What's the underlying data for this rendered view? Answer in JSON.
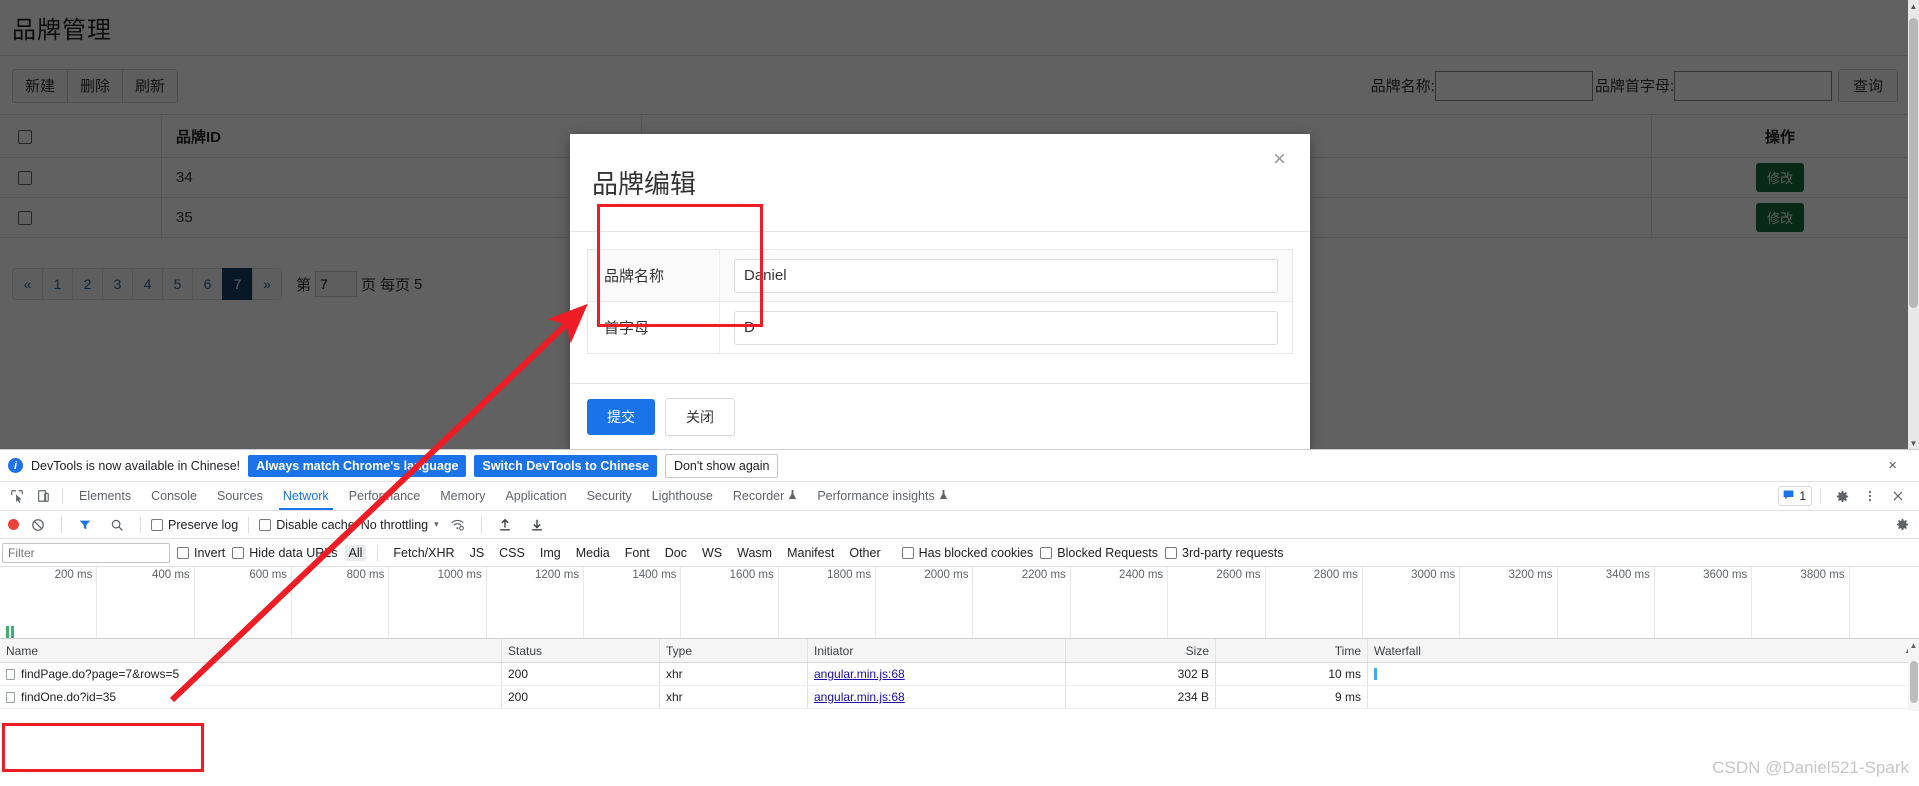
{
  "page": {
    "title": "品牌管理",
    "toolbar_buttons": [
      {
        "label": "新建"
      },
      {
        "label": "删除"
      },
      {
        "label": "刷新"
      }
    ],
    "search": {
      "name_label": "品牌名称:",
      "name_value": "",
      "initial_label": "品牌首字母:",
      "initial_value": "",
      "query_label": "查询"
    },
    "table": {
      "headers": {
        "id": "品牌ID",
        "operation": "操作"
      },
      "rows": [
        {
          "id": "34",
          "action_label": "修改"
        },
        {
          "id": "35",
          "action_label": "修改"
        }
      ]
    },
    "pagination": {
      "prev": "«",
      "pages": [
        "1",
        "2",
        "3",
        "4",
        "5",
        "6",
        "7"
      ],
      "active_page": "7",
      "next": "»",
      "page_prefix": "第",
      "page_value": "7",
      "page_suffix": "页",
      "rows_prefix": "每页",
      "rows_value": "5"
    }
  },
  "modal": {
    "title": "品牌编辑",
    "close_icon": "×",
    "fields": [
      {
        "label": "品牌名称",
        "value": "Daniel"
      },
      {
        "label": "首字母",
        "value": "D"
      }
    ],
    "submit_label": "提交",
    "cancel_label": "关闭"
  },
  "devtools": {
    "notice": {
      "icon": "i",
      "text": "DevTools is now available in Chinese!",
      "primary_button": "Always match Chrome's language",
      "secondary_button": "Switch DevTools to Chinese",
      "dismiss_button": "Don't show again",
      "close_icon": "×"
    },
    "tabs": [
      {
        "label": "Elements",
        "active": false
      },
      {
        "label": "Console",
        "active": false
      },
      {
        "label": "Sources",
        "active": false
      },
      {
        "label": "Network",
        "active": true
      },
      {
        "label": "Performance",
        "active": false
      },
      {
        "label": "Memory",
        "active": false
      },
      {
        "label": "Application",
        "active": false
      },
      {
        "label": "Security",
        "active": false
      },
      {
        "label": "Lighthouse",
        "active": false
      },
      {
        "label": "Recorder",
        "active": false
      },
      {
        "label": "Performance insights",
        "active": false
      }
    ],
    "tabs_right": {
      "message_count": "1",
      "settings_icon": "gear-icon",
      "more_icon": "kebab-icon",
      "close_icon": "×"
    },
    "toolbar": {
      "record_icon": "record-icon",
      "clear_icon": "clear-icon",
      "filter_icon": "funnel-icon",
      "search_icon": "search-icon",
      "preserve_log": "Preserve log",
      "disable_cache": "Disable cache",
      "throttling": "No throttling",
      "caret": "▾",
      "wifi_icon": "network-conditions-icon",
      "import_icon": "import-har-icon",
      "export_icon": "export-har-icon",
      "settings_icon": "gear-icon"
    },
    "filterbar": {
      "filter_placeholder": "Filter",
      "filter_value": "",
      "invert": "Invert",
      "hide_data_urls": "Hide data URLs",
      "types": [
        "All",
        "Fetch/XHR",
        "JS",
        "CSS",
        "Img",
        "Media",
        "Font",
        "Doc",
        "WS",
        "Wasm",
        "Manifest",
        "Other"
      ],
      "selected_type": "All",
      "has_blocked_cookies": "Has blocked cookies",
      "blocked_requests": "Blocked Requests",
      "third_party": "3rd-party requests"
    },
    "timeline": {
      "ticks": [
        "200 ms",
        "400 ms",
        "600 ms",
        "800 ms",
        "1000 ms",
        "1200 ms",
        "1400 ms",
        "1600 ms",
        "1800 ms",
        "2000 ms",
        "2200 ms",
        "2400 ms",
        "2600 ms",
        "2800 ms",
        "3000 ms",
        "3200 ms",
        "3400 ms",
        "3600 ms",
        "3800 ms"
      ]
    },
    "network_table": {
      "headers": [
        "Name",
        "Status",
        "Type",
        "Initiator",
        "Size",
        "Time",
        "Waterfall"
      ],
      "sort_indicator": "▲",
      "rows": [
        {
          "name": "findPage.do?page=7&rows=5",
          "status": "200",
          "type": "xhr",
          "initiator": "angular.min.js:68",
          "size": "302 B",
          "time": "10 ms"
        },
        {
          "name": "findOne.do?id=35",
          "status": "200",
          "type": "xhr",
          "initiator": "angular.min.js:68",
          "size": "234 B",
          "time": "9 ms"
        }
      ]
    }
  },
  "watermark": "CSDN @Daniel521-Spark",
  "colors": {
    "accent_blue": "#1a73e8",
    "annotation_red": "#ee1c25",
    "edit_green": "#156c3d",
    "active_page": "#163d62"
  }
}
